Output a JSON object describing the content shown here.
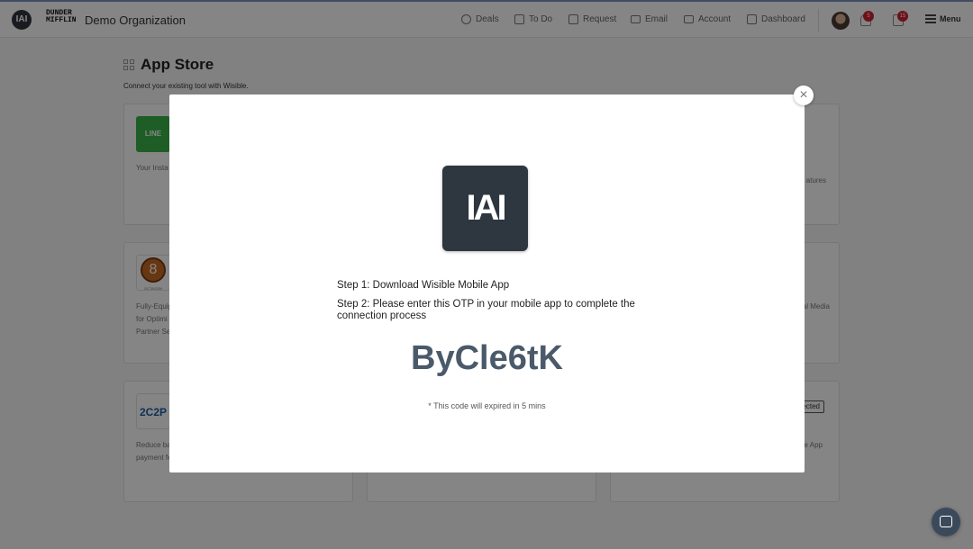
{
  "header": {
    "org_name": "Demo Organization",
    "brand_logo": "DUNDER MIFFLIN",
    "app_logo": "IAI",
    "nav": [
      {
        "label": "Deals",
        "icon": "deals-icon"
      },
      {
        "label": "To Do",
        "icon": "todo-icon"
      },
      {
        "label": "Request",
        "icon": "request-icon"
      },
      {
        "label": "Email",
        "icon": "email-icon"
      },
      {
        "label": "Account",
        "icon": "account-icon"
      },
      {
        "label": "Dashboard",
        "icon": "dashboard-icon"
      }
    ],
    "notifications_count": "5",
    "messages_count": "15",
    "menu_label": "Menu"
  },
  "page": {
    "title": "App Store",
    "subtitle": "Connect your existing tool with Wisible.",
    "cards": [
      {
        "logo": "LINE",
        "lines": [
          "Your Insta"
        ]
      },
      {
        "lines": []
      },
      {
        "lines": [
          "atures"
        ]
      },
      {
        "logo": "OCTAGON",
        "lines": [
          "Fully-Equip",
          "for Optimi",
          "Partner Se"
        ]
      },
      {
        "lines": []
      },
      {
        "lines": [
          "al Media"
        ]
      },
      {
        "logo": "2C2P",
        "lines": [
          "Reduce ba",
          "payment fe"
        ]
      },
      {
        "lines": []
      },
      {
        "button": "ected",
        "lines": [
          "e App"
        ]
      }
    ]
  },
  "modal": {
    "step1": "Step 1: Download Wisible Mobile App",
    "step2": "Step 2: Please enter this OTP in your mobile app to complete the connection process",
    "otp": "ByCle6tK",
    "note": "* This code will expired in 5 mins",
    "close": "×"
  },
  "colors": {
    "brand_dark": "#2e3640",
    "otp_text": "#4a5a6a",
    "badge": "#d0212f"
  }
}
